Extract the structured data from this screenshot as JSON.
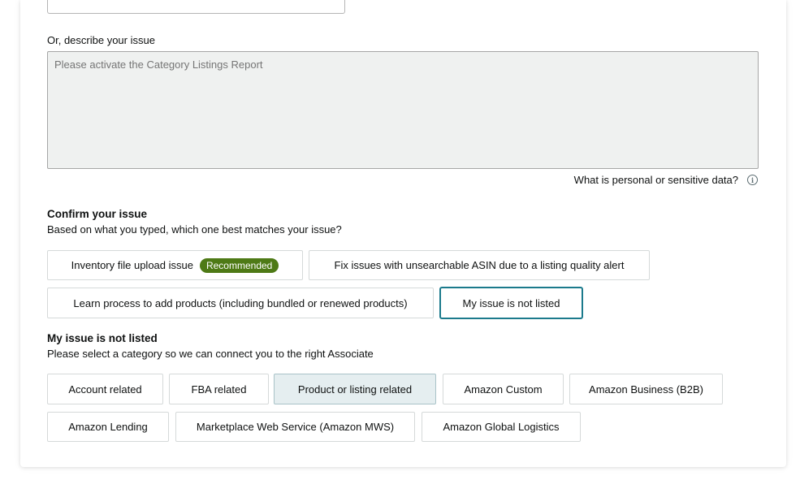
{
  "describe": {
    "label": "Or, describe your issue",
    "placeholder": "Please activate the Category Listings Report"
  },
  "sensitive_link": "What is personal or sensitive data?",
  "confirm": {
    "title": "Confirm your issue",
    "subtitle": "Based on what you typed, which one best matches your issue?",
    "options": [
      {
        "label": "Inventory file upload issue",
        "badge": "Recommended"
      },
      {
        "label": "Fix issues with unsearchable ASIN due to a listing quality alert"
      },
      {
        "label": "Learn process to add products (including bundled or renewed products)"
      },
      {
        "label": "My issue is not listed",
        "selected": true
      }
    ]
  },
  "not_listed": {
    "title": "My issue is not listed",
    "subtitle": "Please select a category so we can connect you to the right Associate",
    "categories": [
      {
        "label": "Account related"
      },
      {
        "label": "FBA related"
      },
      {
        "label": "Product or listing related",
        "selected": true
      },
      {
        "label": "Amazon Custom"
      },
      {
        "label": "Amazon Business (B2B)"
      },
      {
        "label": "Amazon Lending"
      },
      {
        "label": "Marketplace Web Service (Amazon MWS)"
      },
      {
        "label": "Amazon Global Logistics"
      }
    ]
  },
  "colors": {
    "accent_outline": "#1b7a8c",
    "selected_fill": "#e5eef0",
    "badge_green": "#4e7a16",
    "textarea_bg": "#eff1f0"
  },
  "icons": {
    "info": "info-icon"
  }
}
